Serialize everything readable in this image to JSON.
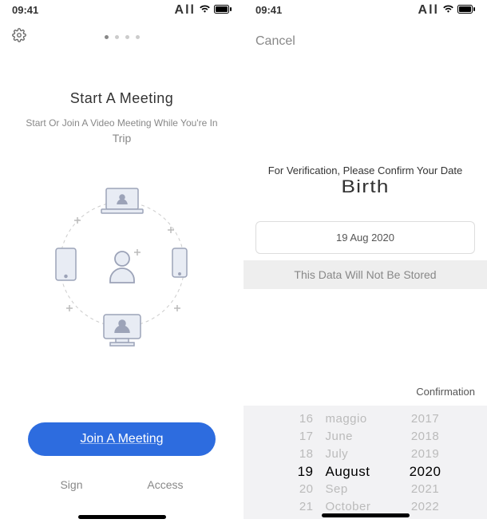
{
  "status": {
    "time": "09:41",
    "carrier": "All"
  },
  "left": {
    "title": "Start A Meeting",
    "subtitle": "Start Or Join A Video Meeting While You're In",
    "subtitle2": "Trip",
    "join_button": "Join A Meeting",
    "sign": "Sign",
    "access": "Access"
  },
  "right": {
    "cancel": "Cancel",
    "verify_line": "For Verification, Please Confirm Your Date",
    "verify_title": "Birth",
    "selected_date": "19 Aug 2020",
    "store_note": "This Data Will Not Be Stored",
    "confirmation": "Confirmation",
    "picker": {
      "days": [
        "16",
        "17",
        "18",
        "19",
        "20",
        "21"
      ],
      "months": [
        "maggio",
        "June",
        "July",
        "August",
        "Sep",
        "October"
      ],
      "years": [
        "2017",
        "2018",
        "2019",
        "2020",
        "2021",
        "2022"
      ],
      "selected_index": 3
    }
  }
}
